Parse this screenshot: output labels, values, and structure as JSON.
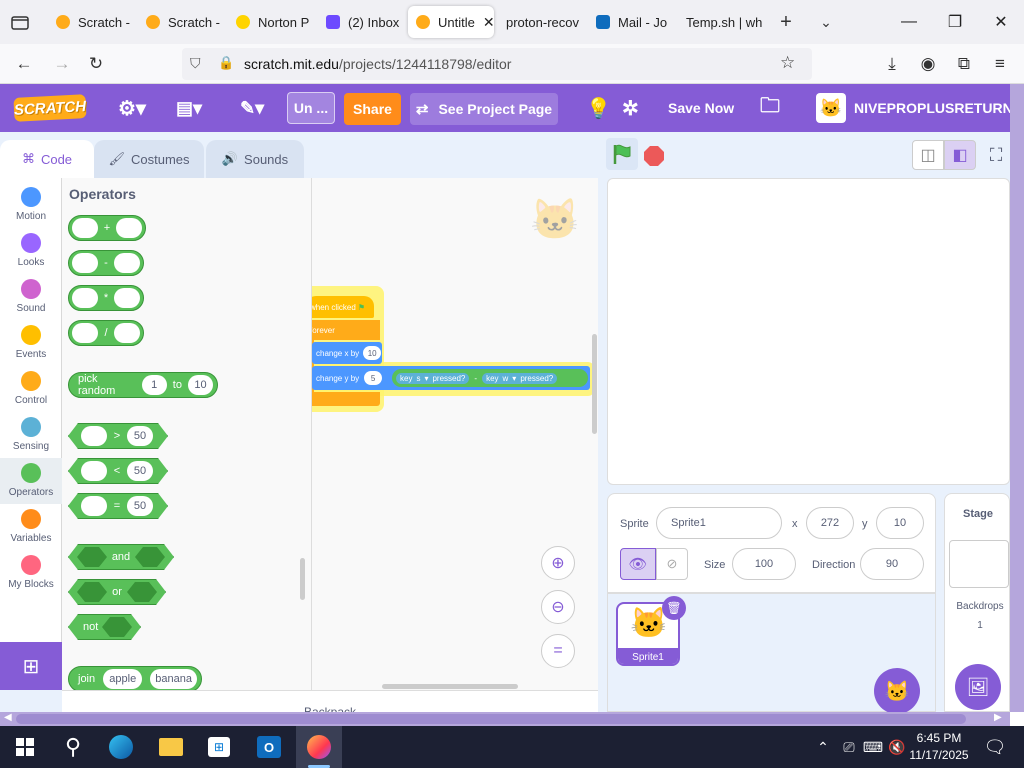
{
  "browser": {
    "tabs": [
      {
        "label": "Scratch -",
        "icon": "scratch-favicon"
      },
      {
        "label": "Scratch -",
        "icon": "scratch-favicon"
      },
      {
        "label": "Norton P",
        "icon": "norton-favicon"
      },
      {
        "label": "(2) Inbox",
        "icon": "proton-mail-favicon"
      },
      {
        "label": "Untitle",
        "icon": "scratch-favicon",
        "active": true
      },
      {
        "label": "proton-recov",
        "icon": "none"
      },
      {
        "label": "Mail - Jo",
        "icon": "outlook-favicon"
      },
      {
        "label": "Temp.sh | wh",
        "icon": "none"
      }
    ],
    "url_host": "scratch.mit.edu",
    "url_path": "/projects/1244118798/editor"
  },
  "scratch_menu": {
    "logo": "SCRATCH",
    "project_title": "Un ...",
    "share": "Share",
    "see_project_page": "See Project Page",
    "save_now": "Save Now",
    "username": "NIVEPROPLUSRETURNS"
  },
  "editor_tabs": {
    "code": "Code",
    "costumes": "Costumes",
    "sounds": "Sounds"
  },
  "categories": [
    {
      "label": "Motion",
      "color": "#4c97ff"
    },
    {
      "label": "Looks",
      "color": "#9966ff"
    },
    {
      "label": "Sound",
      "color": "#cf63cf"
    },
    {
      "label": "Events",
      "color": "#ffbf00"
    },
    {
      "label": "Control",
      "color": "#ffab19"
    },
    {
      "label": "Sensing",
      "color": "#5cb1d6"
    },
    {
      "label": "Operators",
      "color": "#59c059"
    },
    {
      "label": "Variables",
      "color": "#ff8c1a"
    },
    {
      "label": "My Blocks",
      "color": "#ff6680"
    }
  ],
  "palette": {
    "heading": "Operators",
    "op_plus": "+",
    "op_minus": "-",
    "op_times": "*",
    "op_divide": "/",
    "pick_random": "pick random",
    "pick_from": "1",
    "pick_to_word": "to",
    "pick_to": "10",
    "gt": ">",
    "lt": "<",
    "eq": "=",
    "cmp_value": "50",
    "and": "and",
    "or": "or",
    "not": "not",
    "join": "join",
    "join_a": "apple",
    "join_b": "banana",
    "backpack": "Backpack"
  },
  "workspace": {
    "hat": "when clicked",
    "forever": "forever",
    "change_x": "change x by",
    "change_x_val": "10",
    "change_y": "change y by",
    "change_y_val": "5",
    "key1": "key",
    "key1_val": "s",
    "pressed1": "pressed?",
    "minus": "-",
    "key2": "key",
    "key2_val": "w",
    "pressed2": "pressed?"
  },
  "sprite_info": {
    "sprite_label": "Sprite",
    "sprite_name": "Sprite1",
    "x_label": "x",
    "x_val": "272",
    "y_label": "y",
    "y_val": "10",
    "size_label": "Size",
    "size_val": "100",
    "direction_label": "Direction",
    "direction_val": "90"
  },
  "sprite_list": {
    "thumb_name": "Sprite1"
  },
  "stage_panel": {
    "title": "Stage",
    "backdrops_label": "Backdrops",
    "backdrops_count": "1"
  },
  "taskbar": {
    "time": "6:45 PM",
    "date": "11/17/2025"
  }
}
